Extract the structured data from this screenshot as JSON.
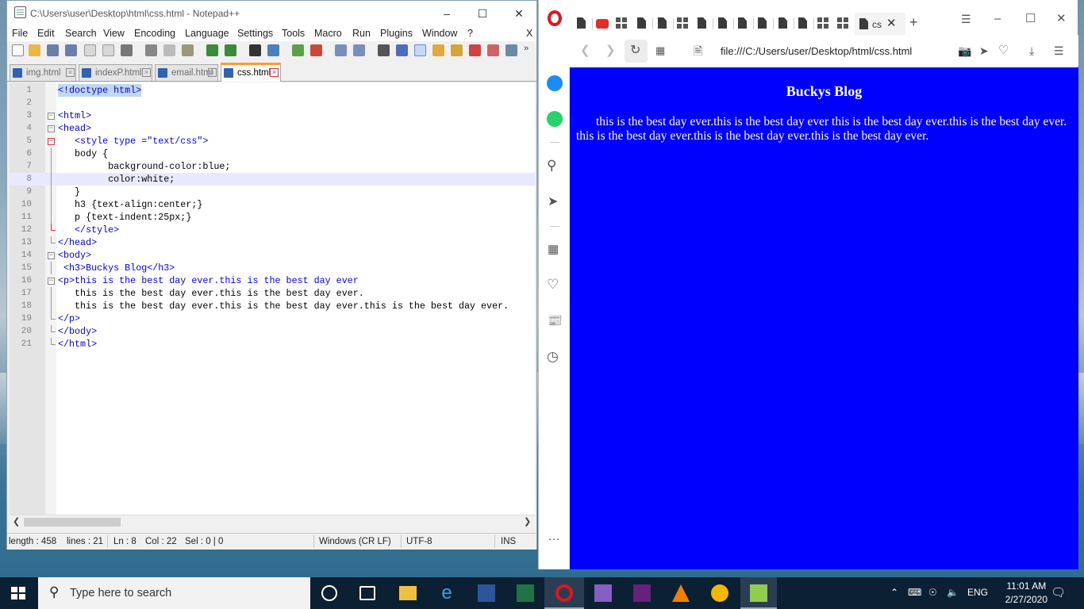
{
  "notepad": {
    "title": "C:\\Users\\user\\Desktop\\html\\css.html - Notepad++",
    "menu": [
      "File",
      "Edit",
      "Search",
      "View",
      "Encoding",
      "Language",
      "Settings",
      "Tools",
      "Macro",
      "Run",
      "Plugins",
      "Window",
      "?"
    ],
    "menu_close": "X",
    "tabs": [
      {
        "label": "img.html"
      },
      {
        "label": "indexP.html"
      },
      {
        "label": "email.html"
      },
      {
        "label": "css.html"
      }
    ],
    "active_tab": "css.html",
    "lines": [
      {
        "n": "1",
        "text": "<!doctype html>"
      },
      {
        "n": "2",
        "text": ""
      },
      {
        "n": "3",
        "text": "<html>"
      },
      {
        "n": "4",
        "text": "<head>"
      },
      {
        "n": "5",
        "text": "   <style type =\"text/css\">"
      },
      {
        "n": "6",
        "text": "   body {"
      },
      {
        "n": "7",
        "text": "         background-color:blue;"
      },
      {
        "n": "8",
        "text": "         color:white;"
      },
      {
        "n": "9",
        "text": "   }"
      },
      {
        "n": "10",
        "text": "   h3 {text-align:center;}"
      },
      {
        "n": "11",
        "text": "   p {text-indent:25px;}"
      },
      {
        "n": "12",
        "text": "   </style>"
      },
      {
        "n": "13",
        "text": "</head>"
      },
      {
        "n": "14",
        "text": "<body>"
      },
      {
        "n": "15",
        "text": " <h3>Buckys Blog</h3>"
      },
      {
        "n": "16",
        "text": "<p>this is the best day ever.this is the best day ever"
      },
      {
        "n": "17",
        "text": "   this is the best day ever.this is the best day ever."
      },
      {
        "n": "18",
        "text": "   this is the best day ever.this is the best day ever.this is the best day ever."
      },
      {
        "n": "19",
        "text": "</p>"
      },
      {
        "n": "20",
        "text": "</body>"
      },
      {
        "n": "21",
        "text": "</html>"
      }
    ],
    "status": {
      "length": "length : 458",
      "lines": "lines : 21",
      "ln": "Ln : 8",
      "col": "Col : 22",
      "sel": "Sel : 0 | 0",
      "eol": "Windows (CR LF)",
      "enc": "UTF-8",
      "mode": "INS"
    }
  },
  "browser": {
    "tab_label": "cs",
    "url": "file:///C:/Users/user/Desktop/html/css.html",
    "page_heading": "Buckys Blog",
    "page_paragraph": "this is the best day ever.this is the best day ever this is the best day ever.this is the best day ever. this is the best day ever.this is the best day ever.this is the best day ever.",
    "more": "…"
  },
  "taskbar": {
    "search_placeholder": "Type here to search",
    "lang": "ENG",
    "time": "11:01 AM",
    "date": "2/27/2020"
  },
  "colors": {
    "page_bg": "#0000ff",
    "opera_red": "#e0161f",
    "npp_tab_accent": "#ff9b34",
    "taskbar": "#0c2033"
  }
}
